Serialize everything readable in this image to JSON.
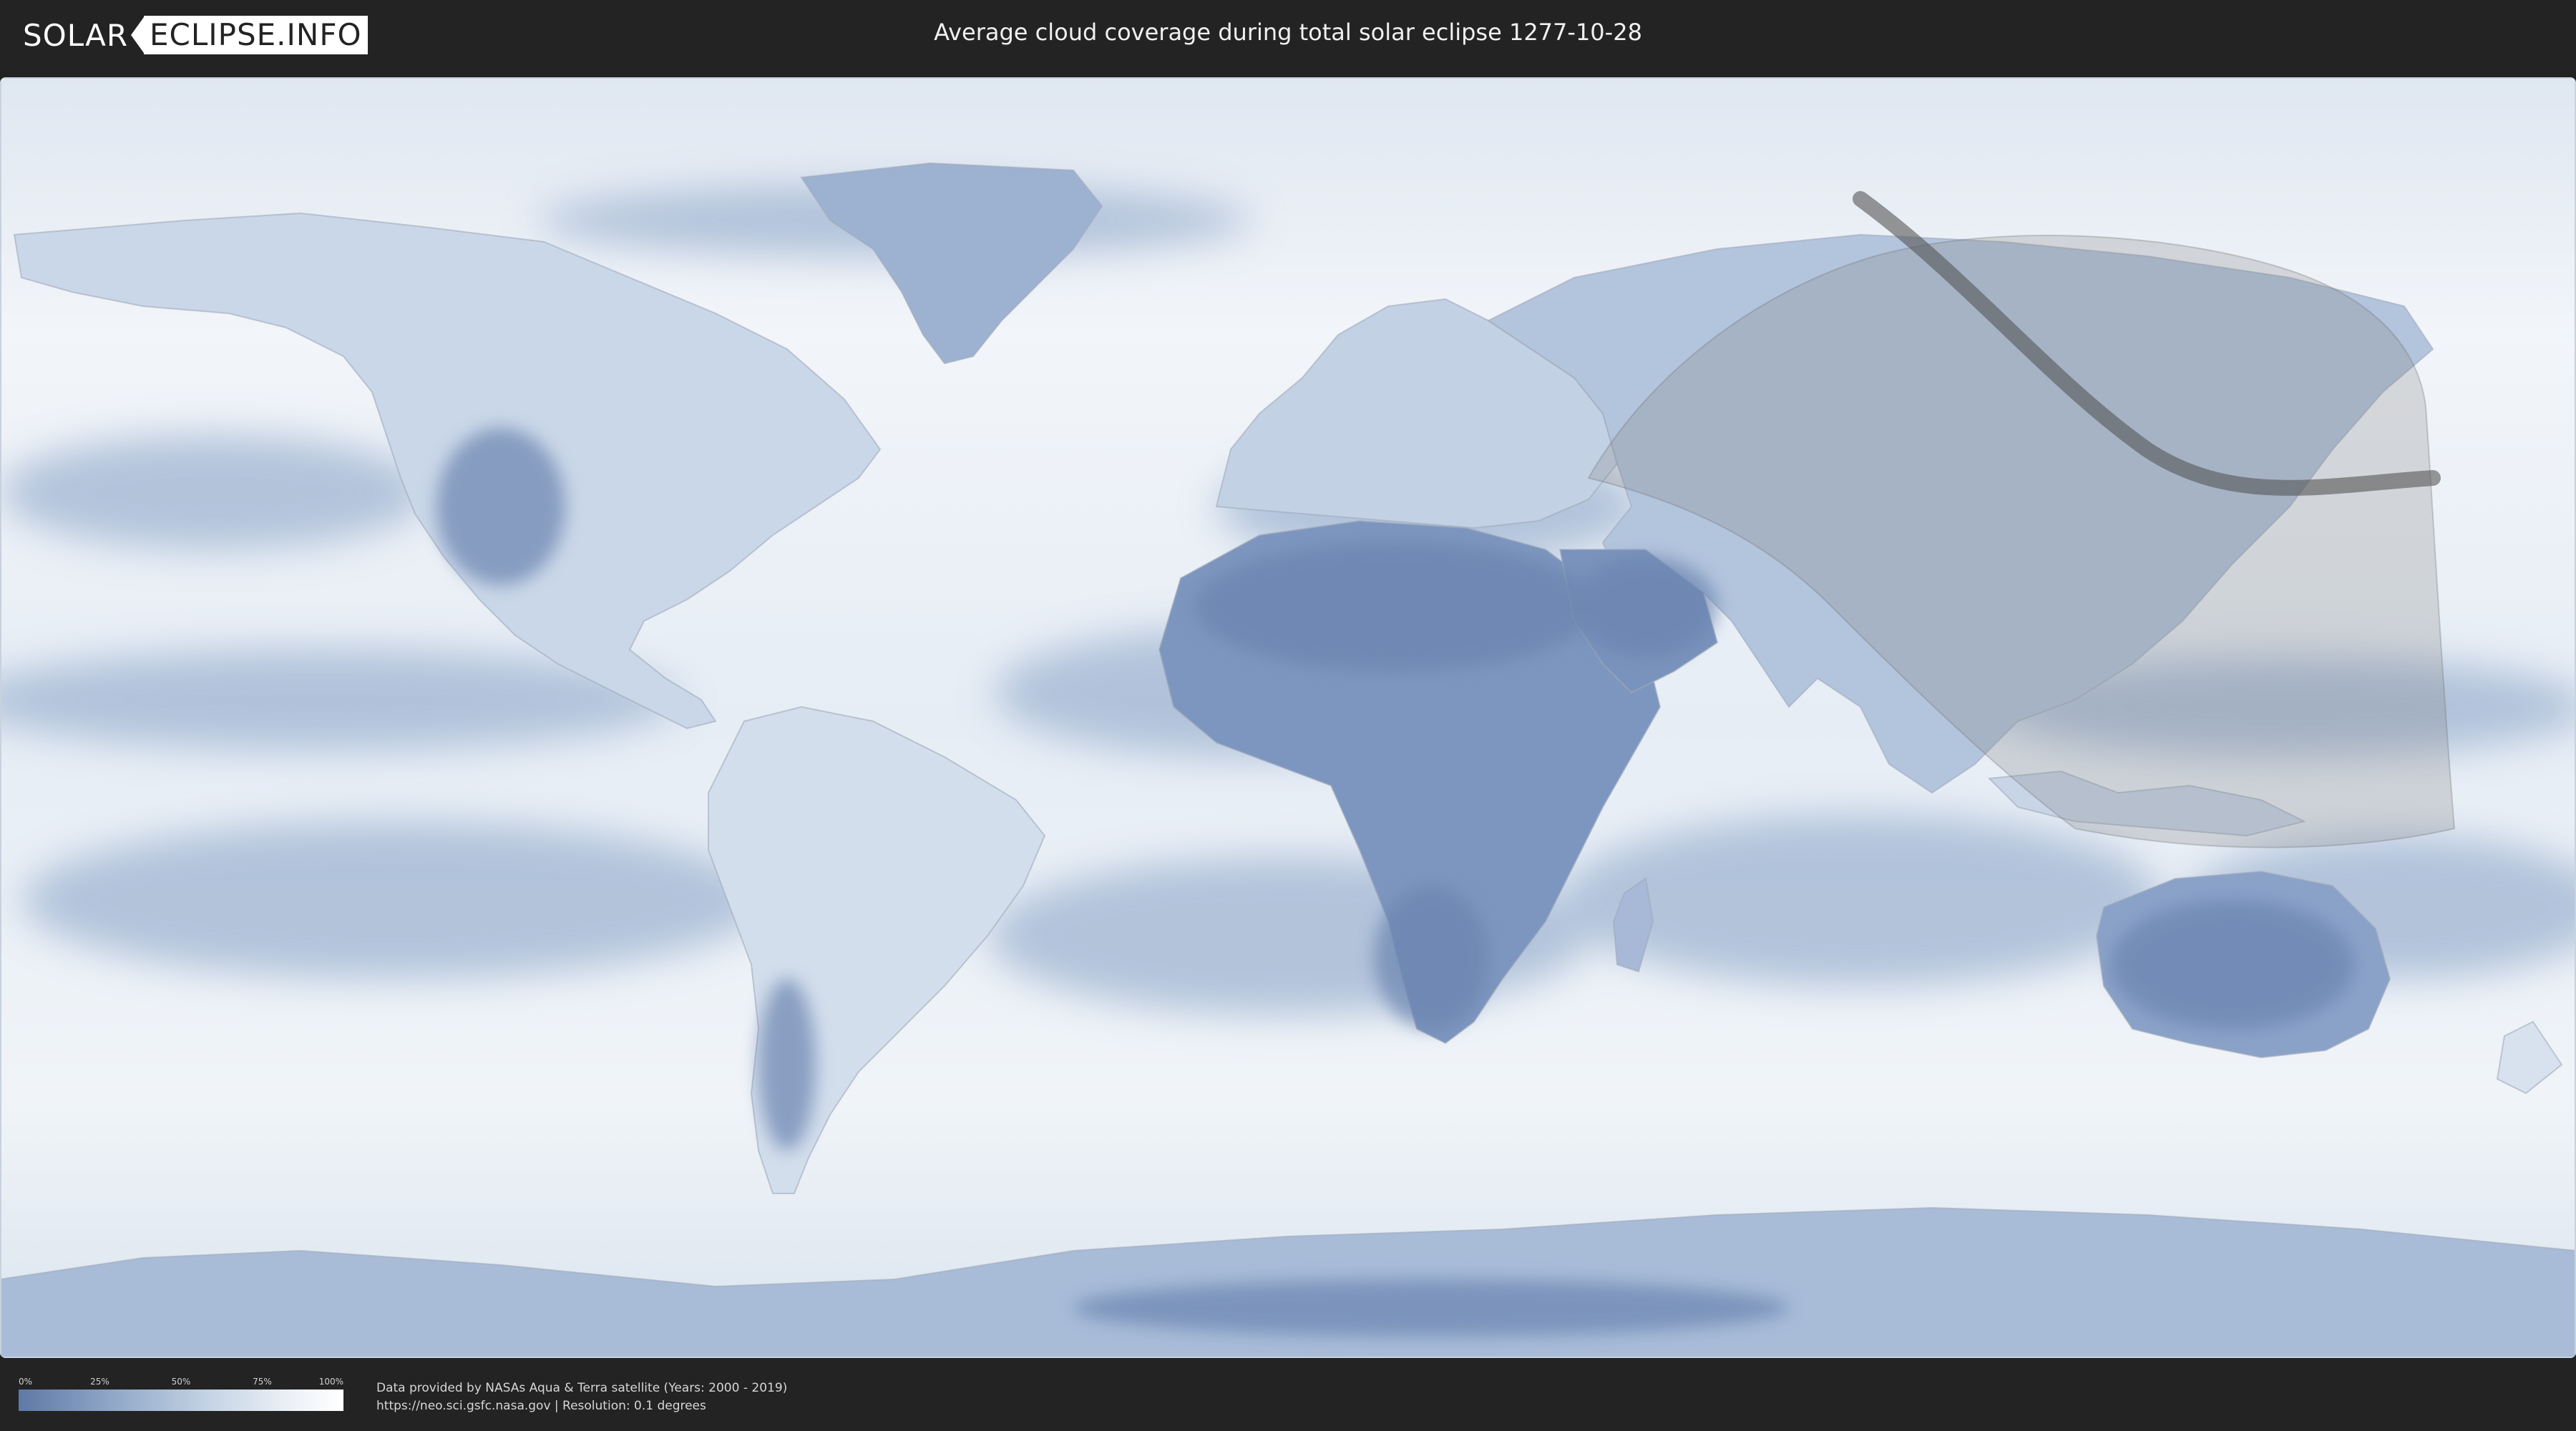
{
  "header": {
    "logo_part1": "SOLAR",
    "logo_part2": "ECLIPSE.INFO",
    "title": "Average cloud coverage during total solar eclipse 1277-10-28"
  },
  "legend": {
    "ticks": [
      "0%",
      "25%",
      "50%",
      "75%",
      "100%"
    ],
    "colors": {
      "low": "#5f79a6",
      "high": "#ffffff"
    }
  },
  "credits": {
    "line1": "Data provided by NASAs Aqua & Terra satellite (Years: 2000 - 2019)",
    "line2": "https://neo.sci.gsfc.nasa.gov | Resolution: 0.1 degrees"
  },
  "map": {
    "projection": "equirectangular",
    "eclipse_date": "1277-10-28",
    "colors": {
      "ocean_cloud": "#eef3f8",
      "clear_sky": "#6f88b3",
      "partial_zone": "#808080",
      "central_path": "#555555"
    }
  }
}
